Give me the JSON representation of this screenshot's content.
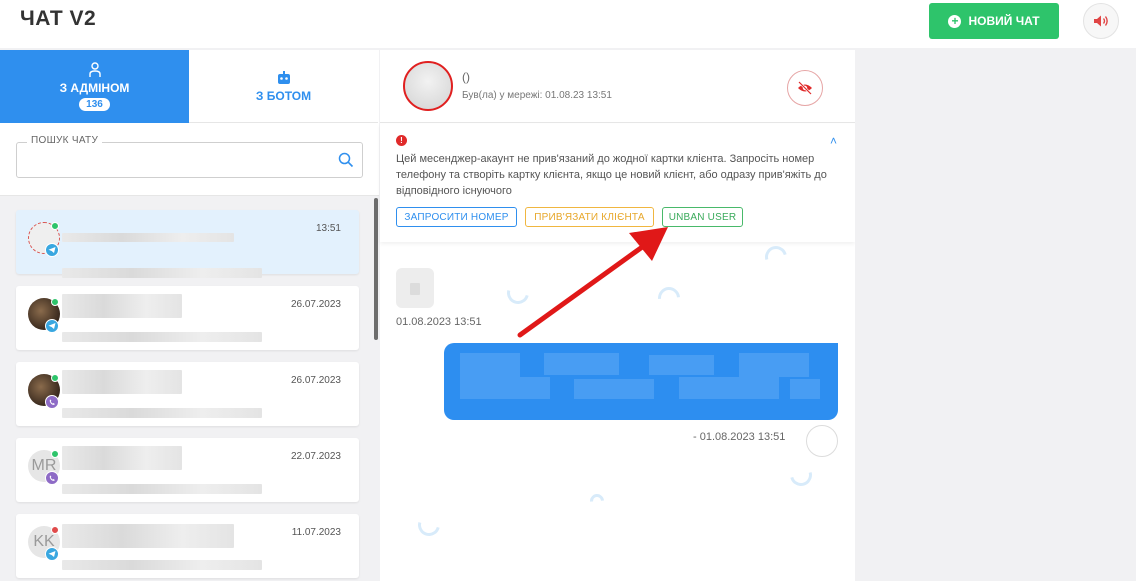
{
  "header": {
    "title": "ЧАТ V2",
    "new_chat_label": "НОВИЙ ЧАТ"
  },
  "tabs": [
    {
      "label": "З АДМІНОМ",
      "badge": "136",
      "active": true
    },
    {
      "label": "З БОТОМ",
      "active": false
    }
  ],
  "search": {
    "label": "ПОШУК ЧАТУ",
    "value": "",
    "placeholder": ""
  },
  "chats": [
    {
      "time": "13:51",
      "messenger": "telegram",
      "avatar_text": "",
      "online": true,
      "active": true
    },
    {
      "time": "26.07.2023",
      "messenger": "telegram",
      "avatar_text": "",
      "online": true,
      "active": false
    },
    {
      "time": "26.07.2023",
      "messenger": "viber",
      "avatar_text": "",
      "online": true,
      "active": false
    },
    {
      "time": "22.07.2023",
      "messenger": "viber",
      "avatar_text": "MR",
      "online": true,
      "active": false
    },
    {
      "time": "11.07.2023",
      "messenger": "telegram",
      "avatar_text": "KK",
      "online": false,
      "active": false
    }
  ],
  "conversation": {
    "name": "()",
    "last_seen": "Був(ла) у мережі: 01.08.23 13:51",
    "alert": {
      "text": "Цей месенджер-акаунт не прив'язаний до жодної картки клієнта. Запросіть номер телефону та створіть картку клієнта, якщо це новий клієнт, або одразу прив'яжіть до відповідного існуючого",
      "request_number_label": "ЗАПРОСИТИ НОМЕР",
      "bind_client_label": "ПРИВ'ЯЗАТИ КЛІЄНТА",
      "unban_label": "UNBAN USER"
    },
    "incoming_time": "01.08.2023 13:51",
    "outgoing_meta": "-  01.08.2023 13:51"
  },
  "colors": {
    "accent": "#2f8fee",
    "new_chat": "#2ec46b",
    "alert_red": "#e02a2a",
    "bind_orange": "#e7a72a",
    "unban_green": "#3aaa5b"
  }
}
